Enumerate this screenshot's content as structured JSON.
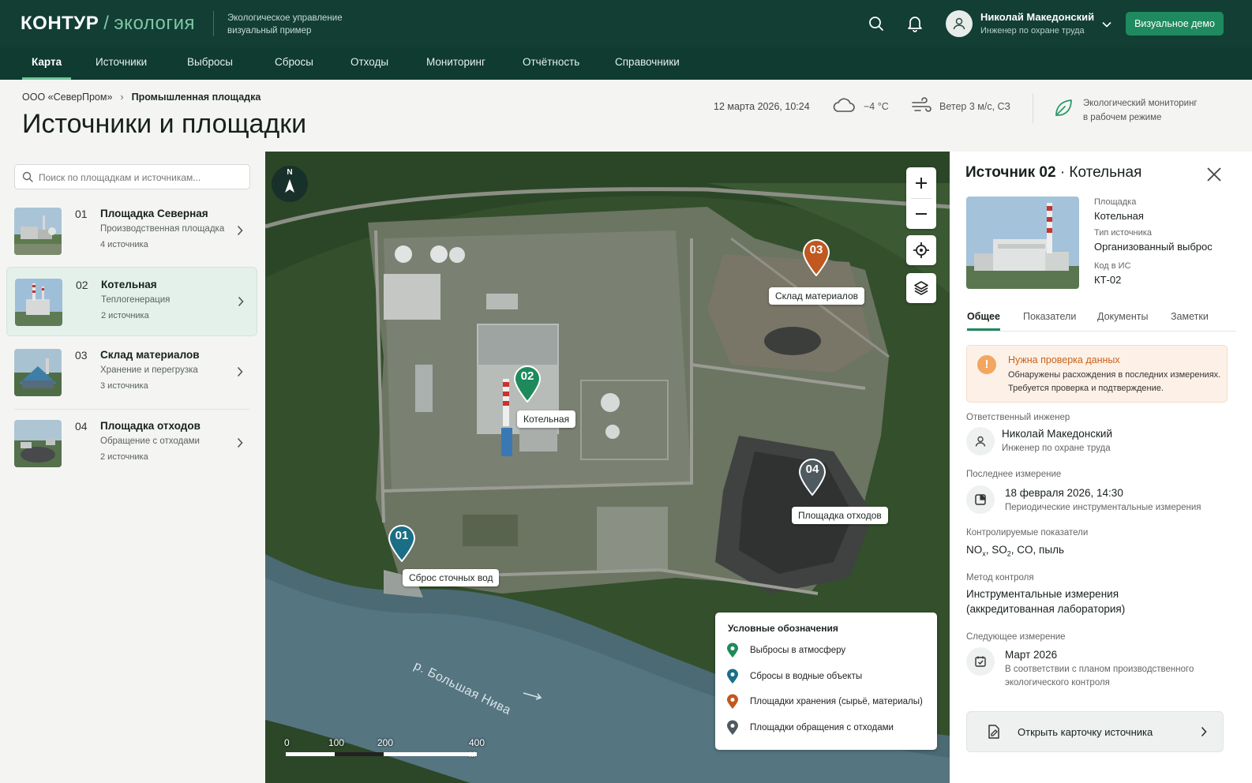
{
  "header": {
    "logo_main": "КОНТУР",
    "logo_slash": "/",
    "logo_eco": "экология",
    "subtitle_line1": "Экологическое управление",
    "subtitle_line2": "визуальный пример",
    "user_name": "Николай Македонский",
    "user_role": "Инженер по охране труда",
    "demo_button": "Визуальное демо"
  },
  "nav": {
    "items": [
      "Карта",
      "Источники",
      "Выбросы",
      "Сбросы",
      "Отходы",
      "Мониторинг",
      "Отчётность",
      "Справочники"
    ],
    "active": "Карта"
  },
  "page": {
    "breadcrumb": [
      "ООО «СеверПром»",
      "Промышленная площадка"
    ],
    "title": "Источники и площадки",
    "datetime": "12 марта 2026, 10:24",
    "temperature": "−4 °C",
    "wind": "Ветер 3 м/с, СЗ",
    "monitoring_line1": "Экологический мониторинг",
    "monitoring_line2": "в рабочем режиме"
  },
  "search": {
    "placeholder": "Поиск по площадкам и источникам..."
  },
  "sites": [
    {
      "num": "01",
      "name": "Площадка Северная",
      "desc": "Производственная площадка",
      "count": "4 источника"
    },
    {
      "num": "02",
      "name": "Котельная",
      "desc": "Теплогенерация",
      "count": "2 источника"
    },
    {
      "num": "03",
      "name": "Склад материалов",
      "desc": "Хранение и перегрузка",
      "count": "3 источника"
    },
    {
      "num": "04",
      "name": "Площадка отходов",
      "desc": "Обращение с отходами",
      "count": "2 источника"
    }
  ],
  "map": {
    "compass": "N",
    "markers": [
      {
        "num": "01",
        "label": "Сброс сточных вод",
        "color": "#1a6f86"
      },
      {
        "num": "02",
        "label": "Котельная",
        "color": "#1e8a5c"
      },
      {
        "num": "03",
        "label": "Склад материалов",
        "color": "#c0581f"
      },
      {
        "num": "04",
        "label": "Площадка отходов",
        "color": "#4f5a60"
      }
    ],
    "river": "р. Большая Нива",
    "legend_title": "Условные обозначения",
    "legend": [
      {
        "label": "Выбросы в атмосферу",
        "color": "#1e8a5c"
      },
      {
        "label": "Сбросы в водные объекты",
        "color": "#1a6f86"
      },
      {
        "label": "Площадки хранения (сырьё, материалы)",
        "color": "#c0581f"
      },
      {
        "label": "Площадки обращения с отходами",
        "color": "#4f5a60"
      }
    ],
    "scale": [
      "0",
      "100",
      "200",
      "400 м"
    ]
  },
  "detail": {
    "title_bold": "Источник 02",
    "title_rest": "· Котельная",
    "site_label": "Площадка",
    "site_value": "Котельная",
    "type_label": "Тип источника",
    "type_value": "Организованный выброс",
    "code_label": "Код в ИС",
    "code_value": "КТ-02",
    "tabs": [
      "Общее",
      "Показатели",
      "Документы",
      "Заметки"
    ],
    "alert_title": "Нужна проверка данных",
    "alert_text": "Обнаружены расхождения в последних измерениях. Требуется проверка и подтверждение.",
    "engineer_label": "Ответственный инженер",
    "engineer_name": "Николай Македонский",
    "engineer_role": "Инженер по охране труда",
    "last_label": "Последнее измерение",
    "last_value": "18 февраля 2026, 14:30",
    "last_note": "Периодические инструментальные измерения",
    "params_label": "Контролируемые показатели",
    "params": {
      "nox": "NO",
      "nox_sub": "x",
      "so2": "SO",
      "so2_sub": "2",
      "rest": ", CO, пыль"
    },
    "method_label": "Метод контроля",
    "method_line1": "Инструментальные измерения",
    "method_line2": "(аккредитованная лаборатория)",
    "next_label": "Следующее измерение",
    "next_value": "Март 2026",
    "next_note1": "В соответствии с планом производственного",
    "next_note2": "экологического контроля",
    "open_button": "Открыть карточку источника"
  }
}
